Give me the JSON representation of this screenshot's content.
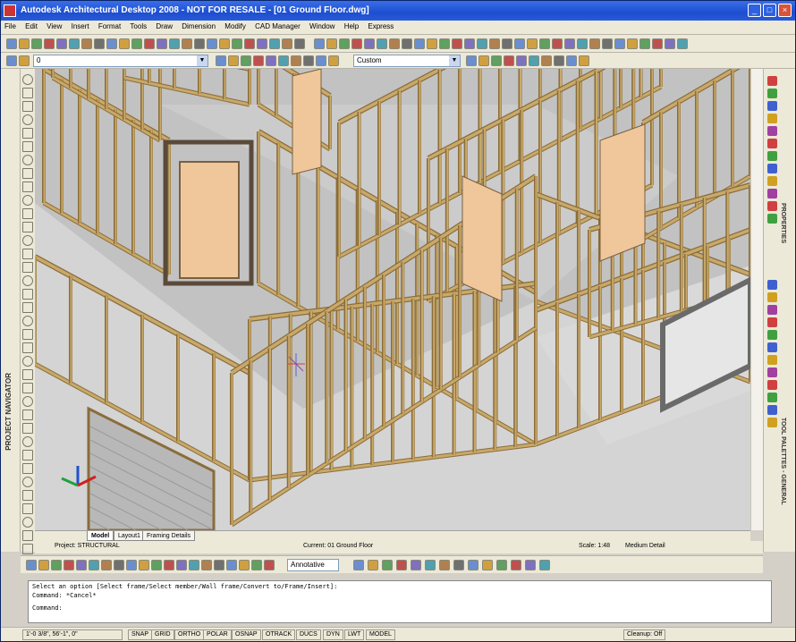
{
  "window": {
    "title": "Autodesk Architectural Desktop 2008 - NOT FOR RESALE - [01 Ground Floor.dwg]",
    "buttons": {
      "minimize": "_",
      "maximize": "□",
      "close": "×"
    }
  },
  "menubar": {
    "items": [
      "File",
      "Edit",
      "View",
      "Insert",
      "Format",
      "Tools",
      "Draw",
      "Dimension",
      "Modify",
      "CAD Manager",
      "Window",
      "Help",
      "Express"
    ]
  },
  "toolbar": {
    "layer_combo_value": "0",
    "style_combo_value": "Custom"
  },
  "panels": {
    "left_title": "PROJECT NAVIGATOR",
    "right_title_top": "PROPERTIES",
    "right_title_bottom": "TOOL PALETTES - GENERAL"
  },
  "tabs": [
    {
      "label": "Model",
      "active": true
    },
    {
      "label": "Layout1",
      "active": false
    },
    {
      "label": "Framing Details",
      "active": false
    }
  ],
  "drawing_status": {
    "project": "Project: STRUCTURAL",
    "context": "Current: 01 Ground Floor",
    "scale": "Scale: 1:48",
    "detail_level": "Medium Detail"
  },
  "bottom_toolbar": {
    "dim_style_value": "Annotative"
  },
  "command_line": {
    "line1": "Select an option [Select frame/Select member/Wall frame/Convert to/Frame/Insert]:",
    "line2": "Command: *Cancel*",
    "line3": "Command:"
  },
  "statusbar": {
    "coordinates": "1'-0 3/8\", 56'-1\", 0\"",
    "toggles": [
      "SNAP",
      "GRID",
      "ORTHO",
      "POLAR",
      "OSNAP",
      "OTRACK",
      "DUCS",
      "DYN",
      "LWT",
      "MODEL"
    ],
    "right_text": "Cleanup: Off"
  },
  "colors": {
    "titlebar": "#1c4ed0",
    "chrome": "#ece9d8",
    "viewport_bg": "#c2c2c2",
    "lumber": "#c9a96a",
    "lumber_dark": "#8a6d3a",
    "door": "#f0c79a",
    "floor": "#d4d4d4"
  }
}
